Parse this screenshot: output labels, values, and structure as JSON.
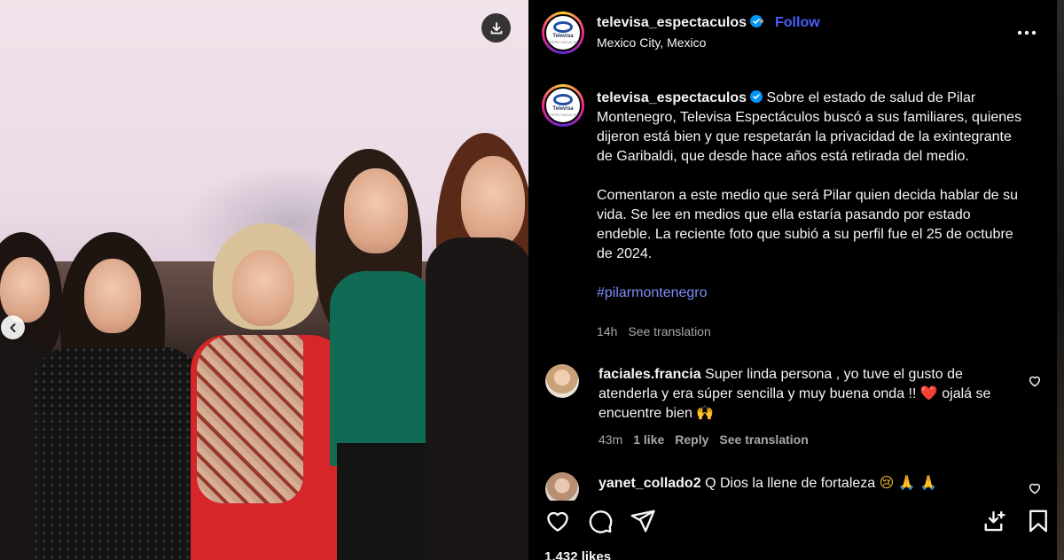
{
  "post": {
    "username": "televisa_espectaculos",
    "follow_label": "Follow",
    "separator": "•",
    "location": "Mexico City, Mexico",
    "logo_text": "Televisa",
    "logo_sub": "ESPECTÁCULOS"
  },
  "caption": {
    "username": "televisa_espectaculos",
    "paragraph1": "Sobre el estado de salud de Pilar Montenegro, Televisa Espectáculos buscó a sus familiares, quienes dijeron está bien y que respetarán la privacidad de la exintegrante de Garibaldi, que desde hace años está retirada del medio.",
    "paragraph2": "Comentaron a este medio que será Pilar quien decida hablar de su vida. Se lee en medios que ella estaría pasando por estado endeble. La reciente foto que subió a su perfil fue el 25 de octubre de 2024.",
    "hashtag": "#pilarmontenegro",
    "time": "14h",
    "see_translation": "See translation"
  },
  "comments": [
    {
      "username": "faciales.francia",
      "text_a": "Super linda persona , yo tuve el gusto de atenderla y era súper sencilla y muy buena onda !! ",
      "emoji_a": "❤️",
      "text_b": " ojalá se encuentre bien ",
      "emoji_b": "🙌",
      "time": "43m",
      "likes": "1 like",
      "reply": "Reply",
      "see_translation": "See translation"
    },
    {
      "username": "yanet_collado2",
      "text": "Q Dios la llene de fortaleza ",
      "emoji": "😢 🙏 🙏"
    }
  ],
  "likes_text": "1,432 likes",
  "icons": {
    "download": "download-icon",
    "prev": "chevron-left-icon",
    "more": "more-icon",
    "like": "heart-icon",
    "comment": "comment-icon",
    "share": "share-icon",
    "save": "bookmark-icon"
  },
  "colors": {
    "link": "#4a5df9",
    "hashtag": "#7b8df5",
    "verified": "#0095f6",
    "muted": "#a8a8a8"
  }
}
